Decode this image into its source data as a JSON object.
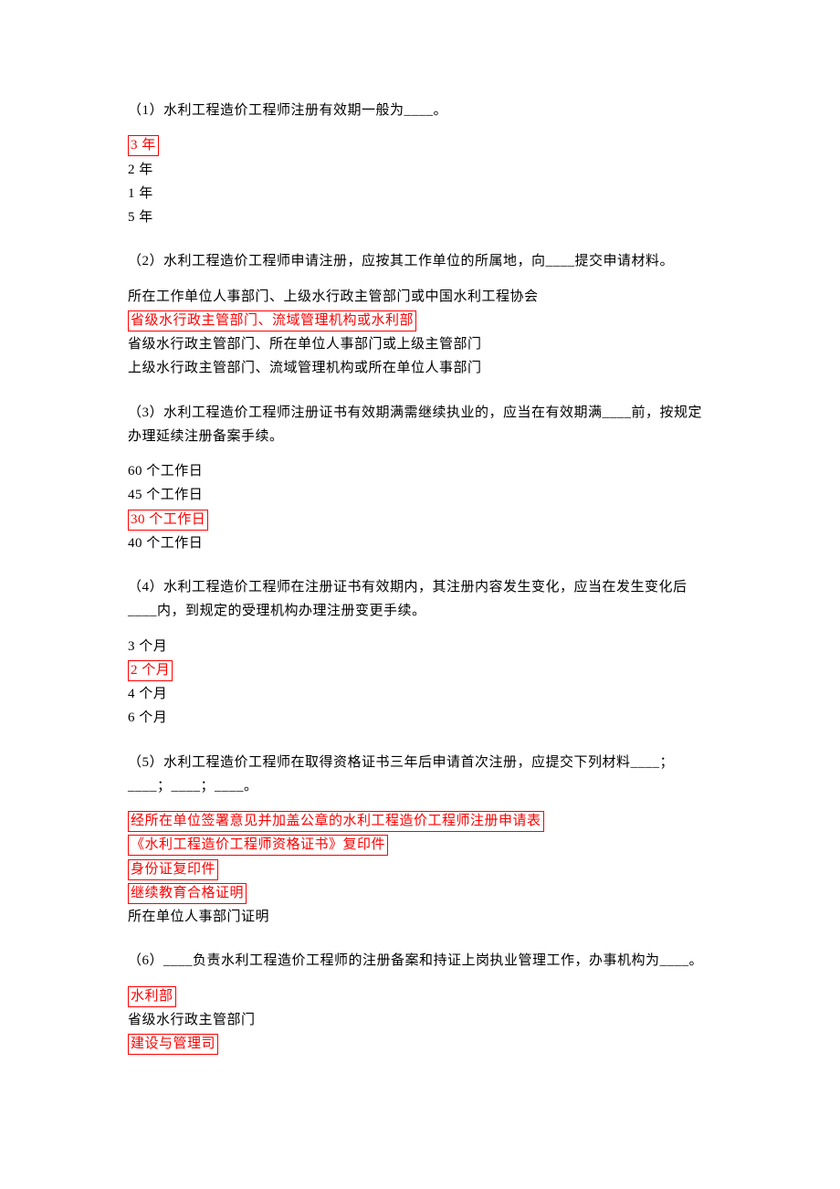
{
  "questions": [
    {
      "text": "（1）水利工程造价工程师注册有效期一般为____。",
      "options": [
        {
          "text": "3 年",
          "highlight": true
        },
        {
          "text": "2 年",
          "highlight": false
        },
        {
          "text": "1 年",
          "highlight": false
        },
        {
          "text": "5 年",
          "highlight": false
        }
      ]
    },
    {
      "text": "（2）水利工程造价工程师申请注册，应按其工作单位的所属地，向____提交申请材料。",
      "options": [
        {
          "text": "所在工作单位人事部门、上级水行政主管部门或中国水利工程协会",
          "highlight": false
        },
        {
          "text": "省级水行政主管部门、流域管理机构或水利部",
          "highlight": true
        },
        {
          "text": "省级水行政主管部门、所在单位人事部门或上级主管部门",
          "highlight": false
        },
        {
          "text": "上级水行政主管部门、流域管理机构或所在单位人事部门",
          "highlight": false
        }
      ]
    },
    {
      "text": "（3）水利工程造价工程师注册证书有效期满需继续执业的，应当在有效期满____前，按规定办理延续注册备案手续。",
      "options": [
        {
          "text": "60 个工作日",
          "highlight": false
        },
        {
          "text": "45 个工作日",
          "highlight": false
        },
        {
          "text": "30 个工作日",
          "highlight": true
        },
        {
          "text": "40 个工作日",
          "highlight": false
        }
      ]
    },
    {
      "text": "（4）水利工程造价工程师在注册证书有效期内，其注册内容发生变化，应当在发生变化后____内，到规定的受理机构办理注册变更手续。",
      "options": [
        {
          "text": "3 个月",
          "highlight": false
        },
        {
          "text": "2 个月",
          "highlight": true
        },
        {
          "text": "4 个月",
          "highlight": false
        },
        {
          "text": "6 个月",
          "highlight": false
        }
      ]
    },
    {
      "text": "（5）水利工程造价工程师在取得资格证书三年后申请首次注册，应提交下列材料____；____；____；____。",
      "options": [
        {
          "text": "经所在单位签署意见并加盖公章的水利工程造价工程师注册申请表",
          "highlight": true
        },
        {
          "text": "《水利工程造价工程师资格证书》复印件",
          "highlight": true
        },
        {
          "text": "身份证复印件",
          "highlight": true
        },
        {
          "text": "继续教育合格证明",
          "highlight": true
        },
        {
          "text": "所在单位人事部门证明",
          "highlight": false
        }
      ]
    },
    {
      "text": "（6）____负责水利工程造价工程师的注册备案和持证上岗执业管理工作，办事机构为____。",
      "options": [
        {
          "text": "水利部",
          "highlight": true
        },
        {
          "text": "省级水行政主管部门",
          "highlight": false
        },
        {
          "text": "建设与管理司",
          "highlight": true
        }
      ]
    }
  ]
}
